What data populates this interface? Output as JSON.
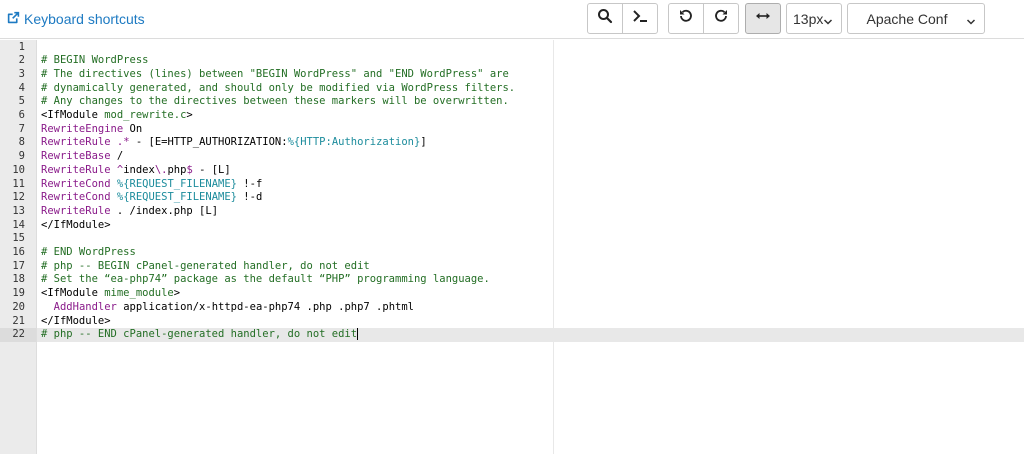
{
  "toolbar": {
    "keyboard_shortcuts_label": "Keyboard shortcuts",
    "font_size": "13px",
    "mode": "Apache Conf",
    "buttons": [
      "search-icon",
      "terminal-icon",
      "undo-icon",
      "redo-icon",
      "wrap-toggle-icon"
    ]
  },
  "colors": {
    "link": "#1d7ac2",
    "comment": "#236e24",
    "keyword": "#8a1b8a",
    "variable": "#1c8c9c"
  },
  "editor": {
    "active_line": 22,
    "lines": [
      [],
      [
        [
          "cmt",
          "# BEGIN WordPress"
        ]
      ],
      [
        [
          "cmt",
          "# The directives (lines) between \"BEGIN WordPress\" and \"END WordPress\" are"
        ]
      ],
      [
        [
          "cmt",
          "# dynamically generated, and should only be modified via WordPress filters."
        ]
      ],
      [
        [
          "cmt",
          "# Any changes to the directives between these markers will be overwritten."
        ]
      ],
      [
        [
          "tag",
          "<IfModule "
        ],
        [
          "cmt",
          "mod_rewrite.c"
        ],
        [
          "tag",
          ">"
        ]
      ],
      [
        [
          "kw",
          "RewriteEngine"
        ],
        [
          "txt",
          " On"
        ]
      ],
      [
        [
          "kw",
          "RewriteRule"
        ],
        [
          "txt",
          " "
        ],
        [
          "kw",
          ".*"
        ],
        [
          "txt",
          " - [E=HTTP_AUTHORIZATION:"
        ],
        [
          "var",
          "%{HTTP:Authorization}"
        ],
        [
          "txt",
          "]"
        ]
      ],
      [
        [
          "kw",
          "RewriteBase"
        ],
        [
          "txt",
          " /"
        ]
      ],
      [
        [
          "kw",
          "RewriteRule"
        ],
        [
          "txt",
          " "
        ],
        [
          "kw",
          "^"
        ],
        [
          "txt",
          "index"
        ],
        [
          "kw",
          "\\."
        ],
        [
          "txt",
          "php"
        ],
        [
          "kw",
          "$"
        ],
        [
          "txt",
          " - [L]"
        ]
      ],
      [
        [
          "kw",
          "RewriteCond"
        ],
        [
          "txt",
          " "
        ],
        [
          "var",
          "%{REQUEST_FILENAME}"
        ],
        [
          "txt",
          " !-f"
        ]
      ],
      [
        [
          "kw",
          "RewriteCond"
        ],
        [
          "txt",
          " "
        ],
        [
          "var",
          "%{REQUEST_FILENAME}"
        ],
        [
          "txt",
          " !-d"
        ]
      ],
      [
        [
          "kw",
          "RewriteRule"
        ],
        [
          "txt",
          " . /index.php [L]"
        ]
      ],
      [
        [
          "tag",
          "</IfModule>"
        ]
      ],
      [],
      [
        [
          "cmt",
          "# END WordPress"
        ]
      ],
      [
        [
          "cmt",
          "# php -- BEGIN cPanel-generated handler, do not edit"
        ]
      ],
      [
        [
          "cmt",
          "# Set the “ea-php74” package as the default “PHP” programming language."
        ]
      ],
      [
        [
          "tag",
          "<IfModule "
        ],
        [
          "cmt",
          "mime_module"
        ],
        [
          "tag",
          ">"
        ]
      ],
      [
        [
          "txt",
          "  "
        ],
        [
          "kw",
          "AddHandler"
        ],
        [
          "txt",
          " application/x-httpd-ea-php74 .php .php7 .phtml"
        ]
      ],
      [
        [
          "tag",
          "</IfModule>"
        ]
      ],
      [
        [
          "cmt",
          "# php -- END cPanel-generated handler, do not edit"
        ]
      ]
    ]
  }
}
